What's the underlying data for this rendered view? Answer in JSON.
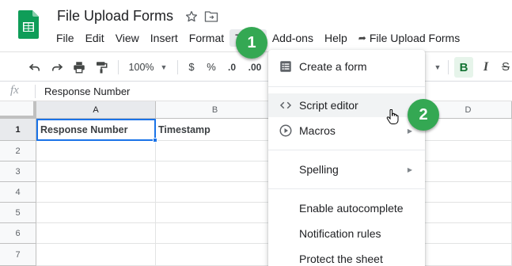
{
  "document": {
    "title": "File Upload Forms",
    "last_edit_label": "File Upload Forms"
  },
  "menu": {
    "items": [
      "File",
      "Edit",
      "View",
      "Insert",
      "Format",
      "Tools",
      "Add-ons",
      "Help"
    ],
    "active": "Tools"
  },
  "toolbar": {
    "zoom": "100%",
    "currency": "$",
    "percent": "%",
    "decrease_decimal": ".0",
    "increase_decimal": ".00",
    "bold": "B",
    "italic": "I",
    "strikethrough": "S"
  },
  "formula_bar": {
    "fx_label": "fx",
    "value": "Response Number"
  },
  "grid": {
    "columns": [
      "A",
      "B",
      "D"
    ],
    "rows": [
      "1",
      "2",
      "3",
      "4",
      "5",
      "6",
      "7"
    ],
    "cells": {
      "A1": "Response Number",
      "B1": "Timestamp"
    }
  },
  "tools_menu": {
    "items": [
      {
        "label": "Create a form",
        "icon": "form-icon",
        "submenu": false
      },
      {
        "label": "Script editor",
        "icon": "code-icon",
        "submenu": false
      },
      {
        "label": "Macros",
        "icon": "play-circle-icon",
        "submenu": true
      },
      {
        "label": "Spelling",
        "icon": "",
        "submenu": true
      },
      {
        "label": "Enable autocomplete",
        "icon": "",
        "submenu": false
      },
      {
        "label": "Notification rules",
        "icon": "",
        "submenu": false
      },
      {
        "label": "Protect the sheet",
        "icon": "",
        "submenu": false
      }
    ],
    "hovered": "Script editor"
  },
  "annotations": {
    "step1": "1",
    "step2": "2"
  },
  "colors": {
    "badge": "#34a853",
    "selection": "#1a73e8",
    "sheets_green": "#0f9d58"
  }
}
